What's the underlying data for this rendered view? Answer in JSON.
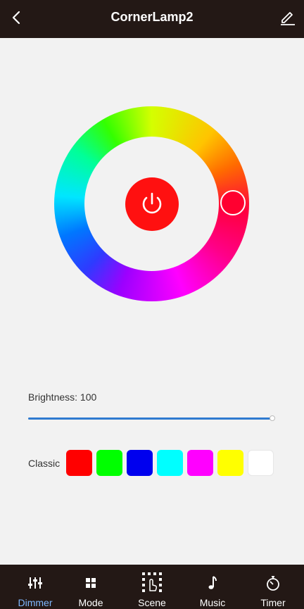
{
  "header": {
    "title": "CornerLamp2",
    "back_icon": "chevron-left-icon",
    "edit_icon": "pencil-icon"
  },
  "color_wheel": {
    "power_icon": "power-icon",
    "power_color": "#ff1010",
    "selected_color": "#ff0030"
  },
  "brightness": {
    "label": "Brightness: 100",
    "value": 100,
    "max": 100,
    "accent_color": "#2f7bd0"
  },
  "classic": {
    "label": "Classic",
    "colors": [
      "#ff0000",
      "#00ff00",
      "#0000ee",
      "#00ffff",
      "#ff00ff",
      "#ffff00",
      "#ffffff"
    ]
  },
  "nav": {
    "active": "Dimmer",
    "items": [
      {
        "label": "Dimmer",
        "icon": "sliders-icon"
      },
      {
        "label": "Mode",
        "icon": "grid-icon"
      },
      {
        "label": "Scene",
        "icon": "scene-icon"
      },
      {
        "label": "Music",
        "icon": "music-note-icon"
      },
      {
        "label": "Timer",
        "icon": "stopwatch-icon"
      }
    ]
  }
}
